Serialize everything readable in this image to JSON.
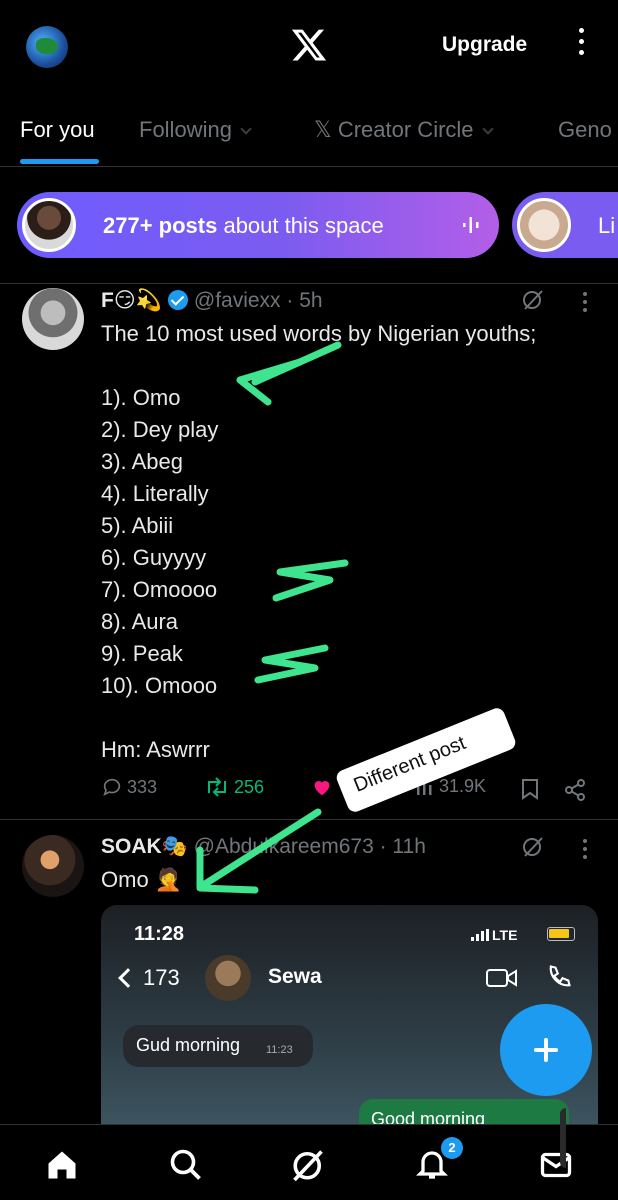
{
  "topbar": {
    "upgrade_label": "Upgrade",
    "icons": [
      "profile-avatar",
      "x-logo",
      "kebab-menu-icon"
    ]
  },
  "tabs": [
    {
      "label": "For you",
      "active": true
    },
    {
      "label": "Following",
      "active": false
    },
    {
      "label": "𝕏 Creator Circle",
      "active": false
    },
    {
      "label": "Geno",
      "active": false
    }
  ],
  "spaces": {
    "pill1_bold": "277+ posts",
    "pill1_rest": " about this space",
    "pill2_text": "Li"
  },
  "post1": {
    "name": "F😏💫",
    "handle": "@faviexx",
    "time": "· 5h",
    "body": "The 10 most used words by Nigerian youths;\n\n1). Omo\n2). Dey play\n3). Abeg\n4). Literally\n5). Abiii\n6). Guyyyy\n7). Omoooo\n8). Aura\n9). Peak\n10). Omooo\n\nHm: Aswrrr",
    "replies": "333",
    "reposts": "256",
    "views": "31.9K"
  },
  "annotation": {
    "sticker_text": "Different post",
    "arrow_color": "#3ee58e"
  },
  "post2": {
    "name": "SOAK🎭",
    "handle": "@Abdulkareem673",
    "time": "· 11h",
    "body": "Omo 🤦",
    "media": {
      "time": "11:28",
      "network": "LTE",
      "back_count": "173",
      "contact_name": "Sewa",
      "msg_in": "Gud morning",
      "msg_in_time": "11:23",
      "msg_out": "Good morning"
    }
  },
  "bottom_nav": {
    "items": [
      "home-icon",
      "search-icon",
      "grok-icon",
      "notifications-icon",
      "messages-icon"
    ],
    "notifications_badge": "2"
  },
  "colors": {
    "accent": "#1d9bf0",
    "background": "#000000",
    "space_gradient_start": "#6f5cff",
    "space_gradient_end": "#b35ee8",
    "repost_green": "#00ba7c",
    "like_pink": "#f91880"
  }
}
